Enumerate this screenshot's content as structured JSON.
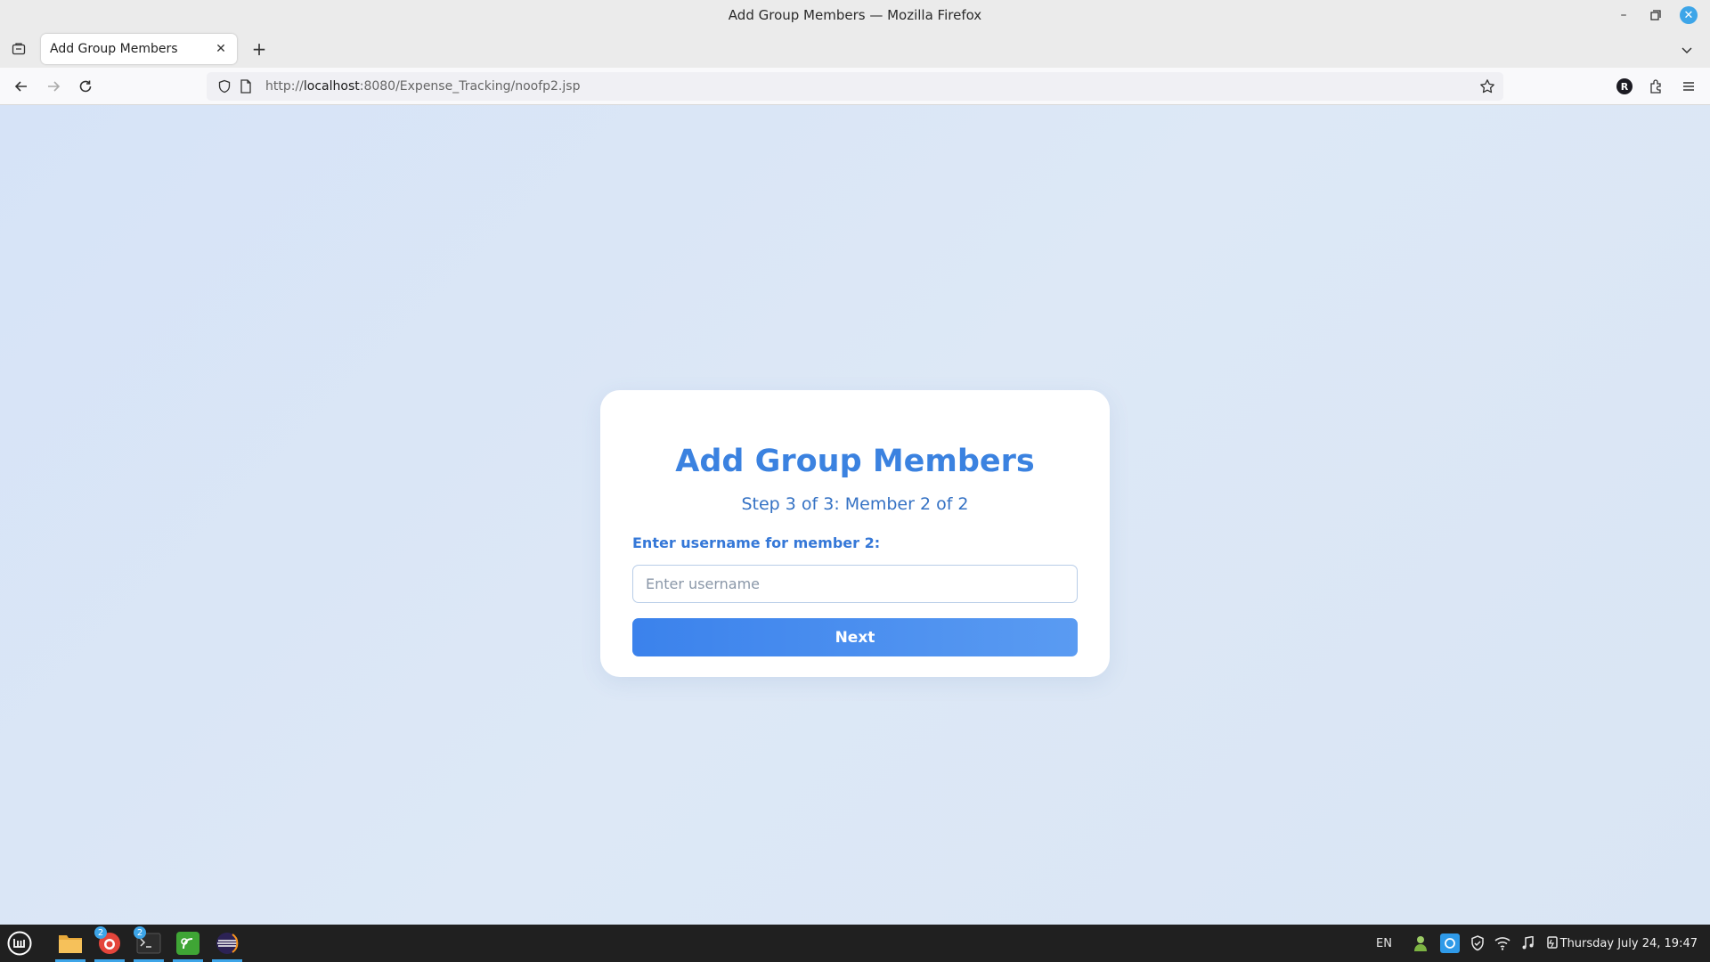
{
  "window": {
    "title": "Add Group Members — Mozilla Firefox"
  },
  "tab": {
    "title": "Add Group Members"
  },
  "urlbar": {
    "prefix": "http://",
    "host": "localhost",
    "rest": ":8080/Expense_Tracking/noofp2.jsp"
  },
  "profile": {
    "initial": "R"
  },
  "page": {
    "heading": "Add Group Members",
    "step": "Step 3 of 3: Member 2 of 2",
    "label": "Enter username for member 2:",
    "input_placeholder": "Enter username",
    "input_value": "",
    "button": "Next"
  },
  "colors": {
    "accent": "#3b82e0",
    "background": "#dbe6f5",
    "taskbar": "#202020"
  },
  "taskbar": {
    "apps": [
      {
        "name": "files-icon",
        "badge": ""
      },
      {
        "name": "firefox-icon",
        "badge": "2"
      },
      {
        "name": "terminal-icon",
        "badge": "2"
      },
      {
        "name": "app-green-icon",
        "badge": ""
      },
      {
        "name": "eclipse-icon",
        "badge": ""
      }
    ],
    "lang": "EN",
    "clock": "Thursday July 24, 19:47"
  }
}
